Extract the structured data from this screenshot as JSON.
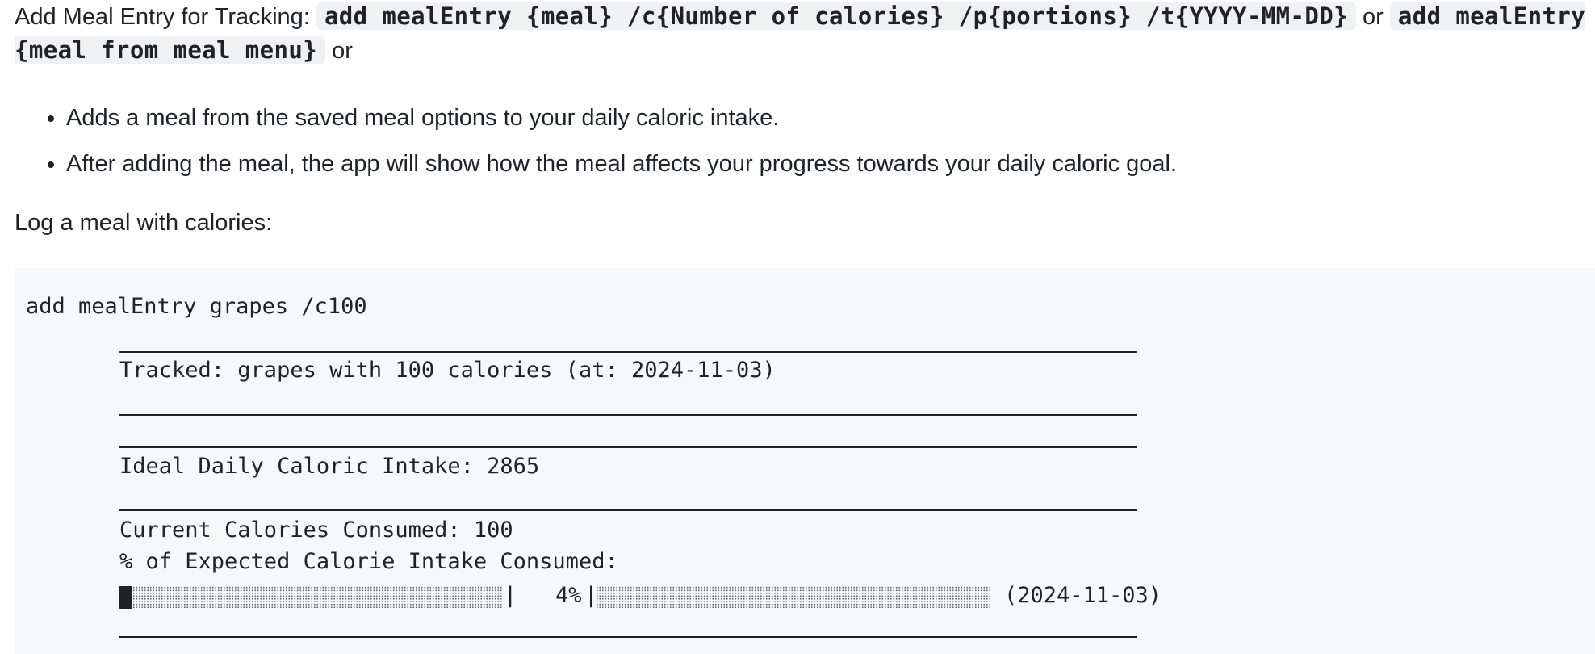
{
  "heading": {
    "title": "Add Meal Entry for Tracking: ",
    "syntax_1": "add mealEntry {meal} /c{Number of calories} /p{portions} /t{YYYY-MM-DD}",
    "or_1": " or ",
    "syntax_2": "add mealEntry {meal from meal menu}",
    "or_2": " or"
  },
  "bullets": [
    "Adds a meal from the saved meal options to your daily caloric intake.",
    "After adding the meal, the app will show how the meal affects your progress towards your daily caloric goal."
  ],
  "example_intro": "Log a meal with calories:",
  "code": {
    "command": "add mealEntry grapes /c100",
    "tracked": "Tracked: grapes with 100 calories (at: 2024-11-03)",
    "ideal": "Ideal Daily Caloric Intake: 2865",
    "current": "Current Calories Consumed: 100",
    "percent_label": "% of Expected Calorie Intake Consumed:",
    "bar_separator": "|",
    "percent_value": "4%",
    "bar_date": "(2024-11-03)",
    "progress_fraction": 0.04
  }
}
